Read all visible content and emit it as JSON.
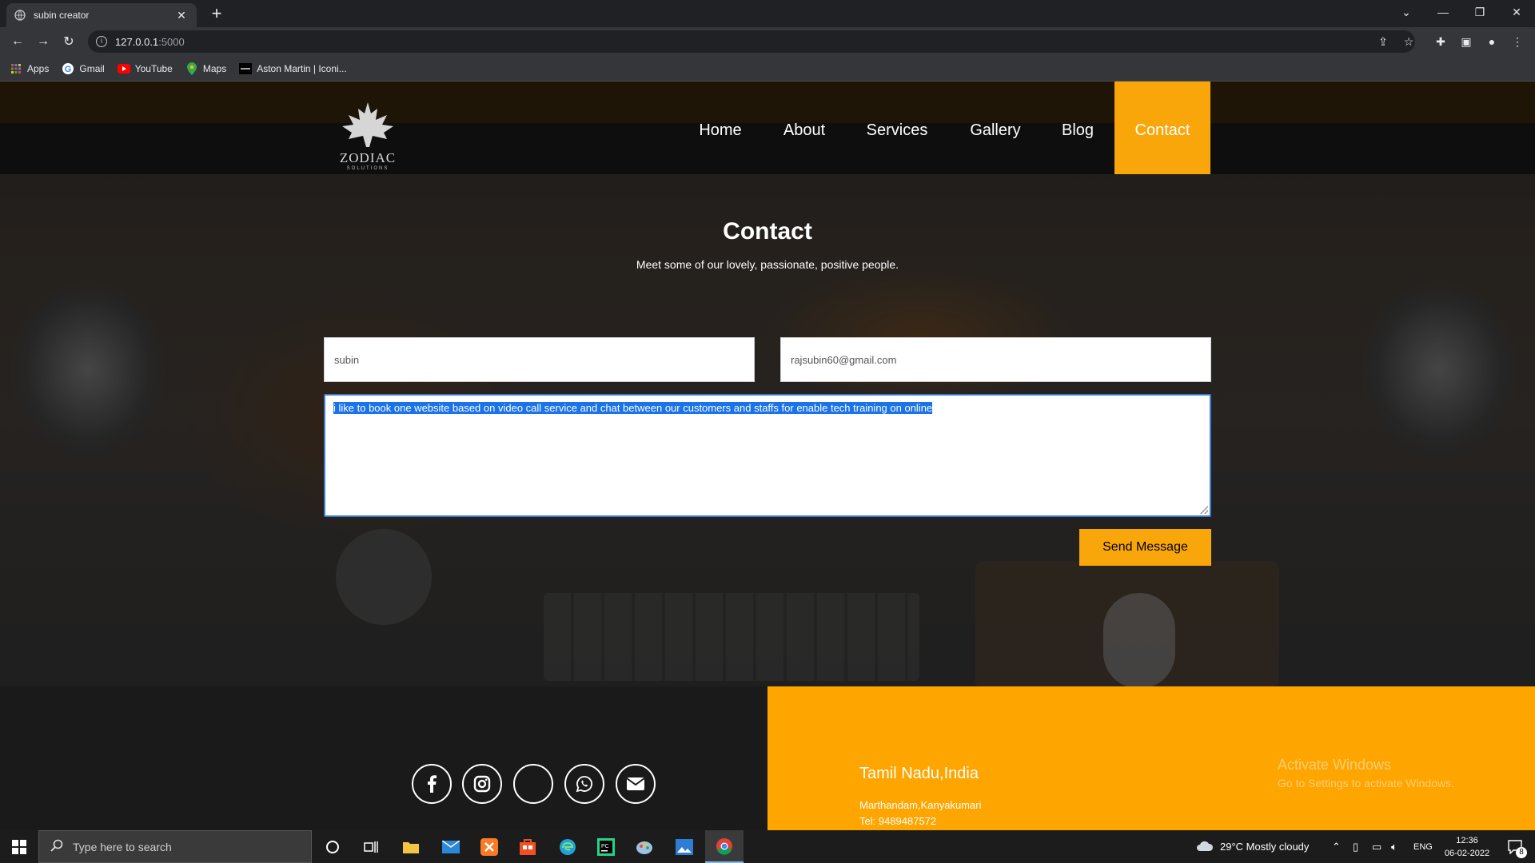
{
  "browser": {
    "tab_title": "subin creator",
    "tab_close": "✕",
    "new_tab": "+",
    "url_host": "127.0.0.1",
    "url_port": ":5000",
    "bookmarks": [
      "Apps",
      "Gmail",
      "YouTube",
      "Maps",
      "Aston Martin | Iconi..."
    ]
  },
  "site": {
    "logo_text": "ZODIAC",
    "logo_subtext": "SOLUTIONS",
    "nav": [
      "Home",
      "About",
      "Services",
      "Gallery",
      "Blog",
      "Contact"
    ],
    "active_nav": "Contact",
    "accent_color": "#f9a60a",
    "contact_title": "Contact",
    "contact_subtitle": "Meet some of our lovely, passionate, positive people.",
    "form": {
      "name_value": "subin",
      "email_value": "rajsubin60@gmail.com",
      "message_value": "i like to book one website based on video call service and chat between our customers  and staffs for enable tech training on online",
      "send_label": "Send Message"
    },
    "footer": {
      "social_icons": [
        "facebook-icon",
        "instagram-icon",
        "blank-icon",
        "whatsapp-icon",
        "envelope-icon"
      ],
      "location_title": "Tamil Nadu,India",
      "address": "Marthandam,Kanyakumari",
      "tel": "Tel: 9489487572"
    },
    "watermark_title": "Activate Windows",
    "watermark_sub": "Go to Settings to activate Windows."
  },
  "taskbar": {
    "search_placeholder": "Type here to search",
    "weather": "29°C  Mostly cloudy",
    "language": "ENG",
    "time": "12:36",
    "date": "06-02-2022",
    "notification_count": "8"
  }
}
